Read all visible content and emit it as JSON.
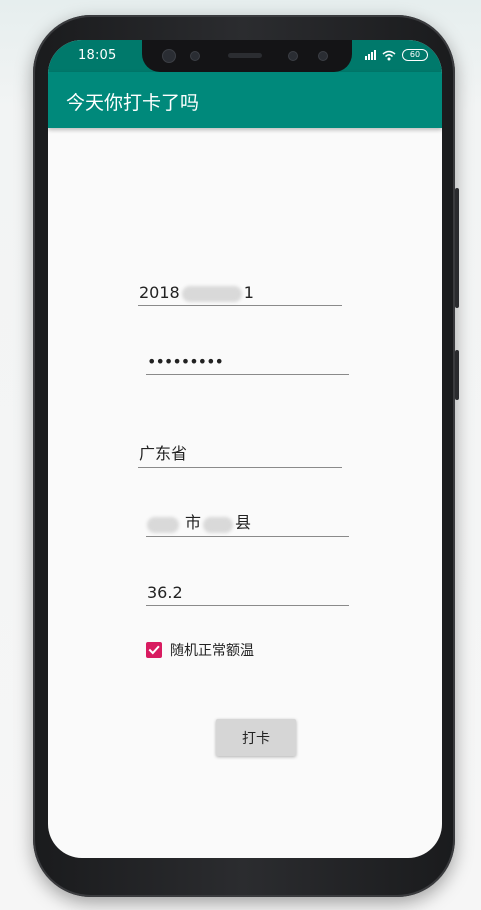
{
  "status_bar": {
    "time": "18:05",
    "battery": "60",
    "signal_icon": "signal-icon",
    "wifi_icon": "wifi-icon",
    "battery_icon": "battery-icon"
  },
  "app_bar": {
    "title": "今天你打卡了吗",
    "color": "#00897b"
  },
  "form": {
    "username_prefix": "2018",
    "username_suffix": "1",
    "password_masked": "•••••••••",
    "province": "广东省",
    "city_mid": "市",
    "county_suffix": "县",
    "temperature": "36.2",
    "random_temp_label": "随机正常额温",
    "random_temp_checked": true,
    "checkbox_color": "#d81b60"
  },
  "actions": {
    "clock_in_label": "打卡"
  }
}
